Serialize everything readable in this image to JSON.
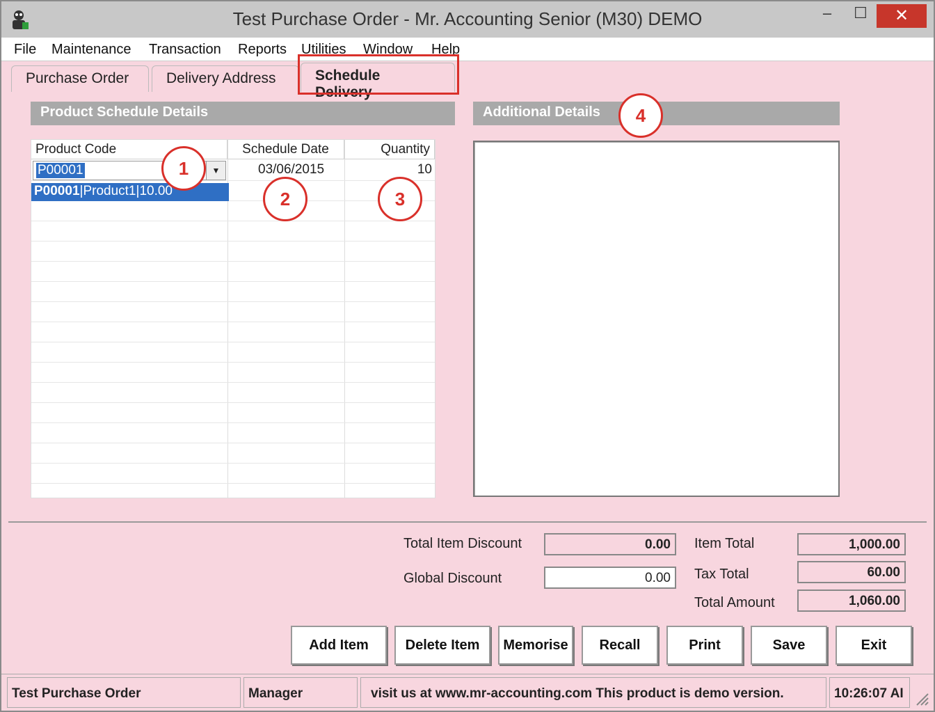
{
  "window": {
    "title": "Test Purchase Order - Mr. Accounting Senior (M30) DEMO",
    "minimize": "–",
    "maximize": "☐",
    "close": "✕"
  },
  "menu": [
    "File",
    "Maintenance",
    "Transaction",
    "Reports",
    "Utilities",
    "Window",
    "Help"
  ],
  "tabs": [
    "Purchase Order",
    "Delivery Address",
    "Schedule Delivery"
  ],
  "active_tab": "Schedule Delivery",
  "product_schedule": {
    "header": "Product Schedule Details",
    "columns": [
      "Product Code",
      "Schedule Date",
      "Quantity"
    ],
    "row": {
      "product_code": "P00001",
      "schedule_date": "03/06/2015",
      "quantity": "10"
    },
    "dropdown_option": {
      "code": "P00001",
      "name": "Product1",
      "price": "10.00"
    }
  },
  "additional_details": {
    "header": "Additional Details",
    "text": ""
  },
  "callouts": [
    "1",
    "2",
    "3",
    "4"
  ],
  "totals": {
    "total_item_discount_label": "Total Item Discount",
    "total_item_discount": "0.00",
    "global_discount_label": "Global Discount",
    "global_discount": "0.00",
    "item_total_label": "Item Total",
    "item_total": "1,000.00",
    "tax_total_label": "Tax Total",
    "tax_total": "60.00",
    "total_amount_label": "Total Amount",
    "total_amount": "1,060.00"
  },
  "buttons": [
    "Add Item",
    "Delete Item",
    "Memorise",
    "Recall",
    "Print",
    "Save",
    "Exit"
  ],
  "status": {
    "form": "Test Purchase Order",
    "user": "Manager",
    "message": "visit us at www.mr-accounting.com This product is demo version.",
    "time": "10:26:07 AI"
  },
  "colors": {
    "background": "#f8d6df",
    "highlight": "#d9302a",
    "selection": "#2f6fc4",
    "section_header": "#a9a9a9"
  }
}
